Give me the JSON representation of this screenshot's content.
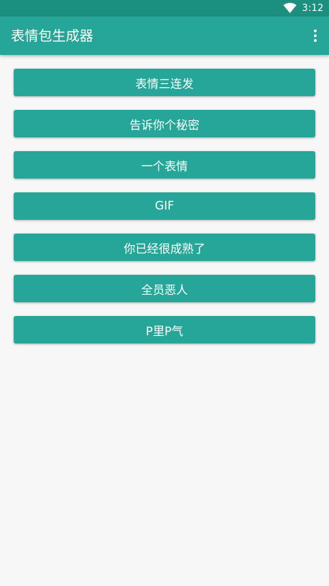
{
  "status_bar": {
    "time": "3:12",
    "icons": [
      "wifi-icon"
    ]
  },
  "app_bar": {
    "title": "表情包生成器",
    "overflow_icon": "more-vert-icon"
  },
  "buttons": [
    {
      "label": "表情三连发"
    },
    {
      "label": "告诉你个秘密"
    },
    {
      "label": "一个表情"
    },
    {
      "label": "GIF"
    },
    {
      "label": "你已经很成熟了"
    },
    {
      "label": "全员恶人"
    },
    {
      "label": "P里P气"
    }
  ],
  "colors": {
    "primary": "#26a698",
    "primary_dark": "#1b8f80",
    "background": "#f7f7f7",
    "on_primary": "#ffffff"
  }
}
